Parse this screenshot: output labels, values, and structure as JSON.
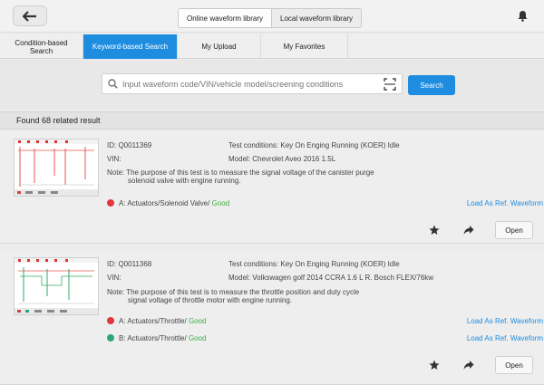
{
  "header": {
    "tabs": [
      {
        "label": "Online waveform library"
      },
      {
        "label": "Local waveform library"
      }
    ]
  },
  "subtabs": [
    {
      "label": "Condition-based Search"
    },
    {
      "label": "Keyword-based Search"
    },
    {
      "label": "My Upload"
    },
    {
      "label": "My Favorites"
    }
  ],
  "search": {
    "placeholder": "Input waveform code/VIN/vehicle model/screening conditions",
    "button_label": "Search"
  },
  "results": {
    "found_text": "Found 68 related result",
    "items": [
      {
        "id": "ID: Q0011369",
        "conditions": "Test conditions: Key On Enging Running (KOER) Idle",
        "vin": "VIN:",
        "model": "Model: Chevrolet Aveo 2016 1.5L",
        "note_line1": "Note: The purpose of this test is to measure the signal voltage of the canister purge",
        "note_line2": "solenoid valve with engine running.",
        "channels": [
          {
            "label": "A: Actuators/Solenoid Valve/",
            "status": "Good",
            "color": "#e0383e",
            "link": "Load As Ref. Waveform"
          }
        ],
        "open_label": "Open"
      },
      {
        "id": "ID: Q0011368",
        "conditions": "Test conditions: Key On Enging Running (KOER) Idle",
        "vin": "VIN:",
        "model": "Model: Volkswagen golf 2014 CCRA 1.6 L R. Bosch FLEX/76kw",
        "note_line1": "Note: The purpose of this test is to measure the throttle position and duty cycle",
        "note_line2": "signal voltage of throttle motor with engine running.",
        "channels": [
          {
            "label": "A: Actuators/Throttle/",
            "status": "Good",
            "color": "#e0383e",
            "link": "Load As Ref. Waveform"
          },
          {
            "label": "B: Actuators/Throttle/",
            "status": "Good",
            "color": "#2aa876",
            "link": "Load As Ref. Waveform"
          }
        ],
        "open_label": "Open"
      }
    ]
  },
  "icons": {
    "back": "arrow-left-icon",
    "notification": "bell-icon",
    "search": "magnifier-icon",
    "scan": "scan-icon",
    "favorite": "star-icon",
    "share": "share-arrow-icon"
  },
  "colors": {
    "accent": "#1e8de0",
    "good": "#3cb043"
  }
}
